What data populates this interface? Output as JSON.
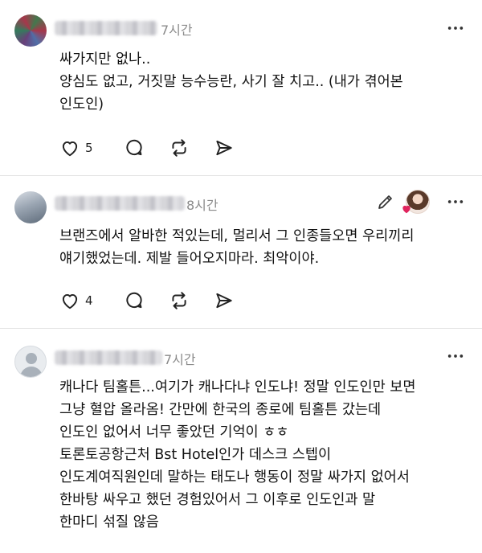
{
  "posts": [
    {
      "time": "7시간",
      "lines": [
        "싸가지만 없나..",
        "양심도 없고, 거짓말 능수능란, 사기 잘 치고.. (내가 겪어본",
        "인도인)"
      ],
      "like_count": "5",
      "icons": [
        "heart-icon",
        "comment-icon",
        "repost-icon",
        "share-icon",
        "more-icon"
      ]
    },
    {
      "time": "8시간",
      "lines": [
        "브랜즈에서 알바한 적있는데, 멀리서 그 인종들오면 우리끼리",
        "얘기했었는데. 제발 들어오지마라. 최악이야."
      ],
      "like_count": "4",
      "icons": [
        "heart-icon",
        "comment-icon",
        "repost-icon",
        "share-icon",
        "edit-icon",
        "more-icon"
      ]
    },
    {
      "time": "7시간",
      "lines": [
        "캐나다 팀홀튼...여기가 캐나다냐 인도냐! 정말 인도인만 보면",
        "그냥 혈압 올라옴! 간만에 한국의 종로에 팀홀튼 갔는데",
        "인도인 없어서 너무 좋았던 기억이 ㅎㅎ",
        "토론토공항근처 Bst Hotel인가 데스크 스텝이",
        "인도계여직원인데 말하는 태도나 행동이 정말 싸가지 없어서",
        "한바탕 싸우고 했던 경험있어서 그 이후로 인도인과 말",
        "한마디 섞질 않음"
      ]
    }
  ],
  "colors": {
    "accent_heart": "#e0245e",
    "text": "#111111",
    "muted": "#8a8a8a",
    "divider": "#e3e3e3"
  }
}
